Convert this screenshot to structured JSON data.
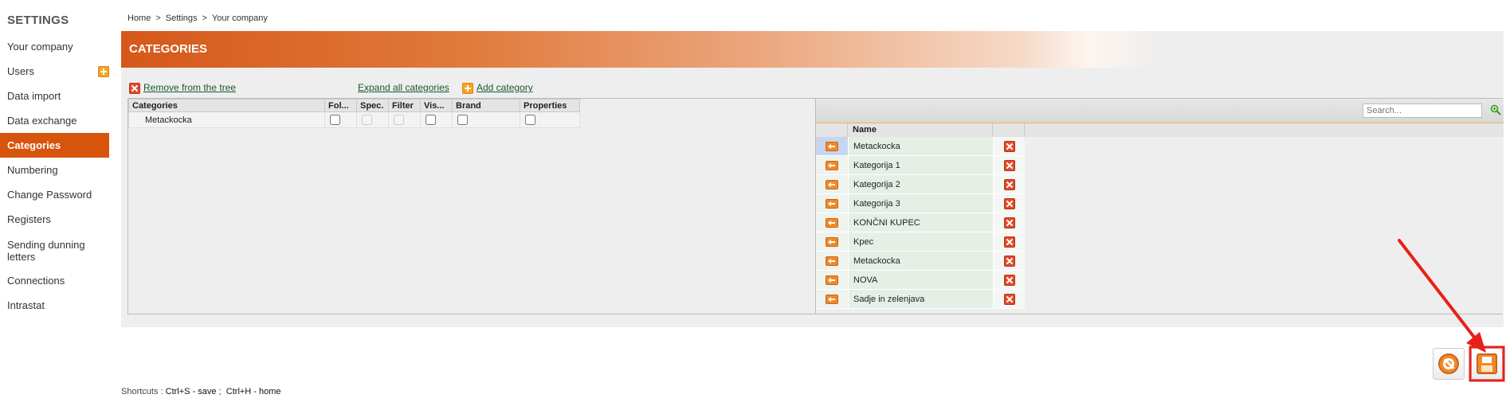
{
  "sidebar": {
    "title": "SETTINGS",
    "items": [
      {
        "label": "Your company"
      },
      {
        "label": "Users"
      },
      {
        "label": "Data import"
      },
      {
        "label": "Data exchange"
      },
      {
        "label": "Categories"
      },
      {
        "label": "Numbering"
      },
      {
        "label": "Change Password"
      },
      {
        "label": "Registers"
      },
      {
        "label": "Sending dunning letters"
      },
      {
        "label": "Connections"
      },
      {
        "label": "Intrastat"
      }
    ]
  },
  "breadcrumb": {
    "home": "Home",
    "settings": "Settings",
    "current": "Your company",
    "sep": ">"
  },
  "header": {
    "title": "CATEGORIES"
  },
  "toolbar": {
    "remove_label": "Remove from the tree",
    "expand_label": "Expand all categories",
    "add_label": "Add category"
  },
  "tree": {
    "columns": [
      "Categories",
      "Fol...",
      "Spec.",
      "Filter",
      "Vis...",
      "Brand",
      "Properties"
    ],
    "rows": [
      {
        "name": "Metackocka"
      }
    ]
  },
  "grid": {
    "search_placeholder": "Search...",
    "name_header": "Name",
    "rows": [
      {
        "name": "Metackocka"
      },
      {
        "name": "Kategorija 1"
      },
      {
        "name": "Kategorija 2"
      },
      {
        "name": "Kategorija 3"
      },
      {
        "name": "KONČNI KUPEC"
      },
      {
        "name": "Kpec"
      },
      {
        "name": "Metackocka"
      },
      {
        "name": "NOVA"
      },
      {
        "name": "Sadje in zelenjava"
      }
    ]
  },
  "shortcuts": {
    "prefix": "Shortcuts :",
    "save": "Ctrl+S - save",
    "sep": ";",
    "home": "Ctrl+H - home"
  },
  "colors": {
    "accent": "#d6540c",
    "link": "#1a5a2a",
    "annotation": "#e8201c"
  }
}
